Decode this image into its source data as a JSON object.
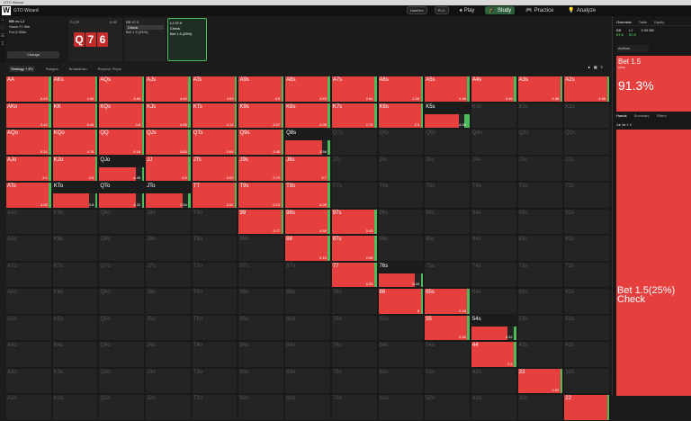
{
  "titlebar": "GTO Wizard",
  "app": {
    "name": "GTO Wizard",
    "mode": "Hold'em",
    "game": "PLO",
    "nav": [
      {
        "label": "Play"
      },
      {
        "label": "Study",
        "active": true
      },
      {
        "label": "Practice"
      },
      {
        "label": "Analyze"
      }
    ]
  },
  "spot": {
    "players": "BB vs LJ",
    "stack": "Stack 97.9bb",
    "pot": "Pot 5.95bb",
    "change_label": "Change",
    "flop_label": "FLOP",
    "flop_value": "5.95",
    "board": [
      "Q",
      "7",
      "6"
    ],
    "bb": {
      "label": "BB",
      "value": "97.9",
      "opt1": "Check",
      "opt2": "Bet 1.5",
      "opt2_pct": "(25%)"
    },
    "lj": {
      "label": "LJ",
      "value": "97.9",
      "opt1": "Check",
      "opt2": "Bet 1.5",
      "opt2_pct": "(25%)"
    }
  },
  "toolbar": {
    "strategy": "Strategy + EV",
    "ranges": "Ranges",
    "breakdown": "Breakdown",
    "reports": "Reports: Flops"
  },
  "right": {
    "tabs": [
      "Overview",
      "Table",
      "Equity"
    ],
    "bb_label": "BB",
    "bb_value": "97.9",
    "lj_label": "LJ",
    "lj_value": "97.9",
    "pot": "5.95 BB",
    "actions": "Actions",
    "action_title": "Bet 1.5",
    "action_pct": "(25%)",
    "action_freq": "91.3%",
    "hands_tabs": [
      "Hands",
      "Summary",
      "Filters"
    ],
    "filter": "A♠ 3♠  1  9",
    "big_label": "Bet 1.5(25%) Check"
  },
  "matrix": [
    [
      {
        "h": "AA",
        "ev": "6.23",
        "r": 0.95
      },
      {
        "h": "AKs",
        "ev": "4.49",
        "r": 0.96
      },
      {
        "h": "AQs",
        "ev": "3.84",
        "r": 0.96
      },
      {
        "h": "AJs",
        "ev": "4.49",
        "r": 0.96
      },
      {
        "h": "ATs",
        "ev": "4.53",
        "r": 0.96
      },
      {
        "h": "A9s",
        "ev": "4.5",
        "r": 0.96
      },
      {
        "h": "A8s",
        "ev": "4.53",
        "r": 0.96
      },
      {
        "h": "A7s",
        "ev": "2.81",
        "r": 0.96
      },
      {
        "h": "A6s",
        "ev": "2.28",
        "r": 0.96
      },
      {
        "h": "A5s",
        "ev": "4.49",
        "r": 0.96
      },
      {
        "h": "A4s",
        "ev": "4.46",
        "r": 0.96
      },
      {
        "h": "A3s",
        "ev": "4.38",
        "r": 0.96
      },
      {
        "h": "A2s",
        "ev": "4.38",
        "r": 0.96
      }
    ],
    [
      {
        "h": "AKo",
        "ev": "3.42",
        "r": 0.96
      },
      {
        "h": "KK",
        "ev": "5.44",
        "r": 0.96
      },
      {
        "h": "KQs",
        "ev": "3.8",
        "r": 0.96
      },
      {
        "h": "KJs",
        "ev": "4.05",
        "r": 0.96
      },
      {
        "h": "KTs",
        "ev": "4.12",
        "r": 0.96
      },
      {
        "h": "K9s",
        "ev": "4.07",
        "r": 0.96
      },
      {
        "h": "K8s",
        "ev": "4.05",
        "r": 0.96
      },
      {
        "h": "K7s",
        "ev": "2.75",
        "r": 0.96
      },
      {
        "h": "K6s",
        "ev": "2.5",
        "r": 0.96
      },
      {
        "h": "K5s",
        "ev": "4.05",
        "r": 0.9,
        "split": true
      },
      {
        "h": "K4s",
        "ev": "",
        "r": 0
      },
      {
        "h": "K3s",
        "ev": "",
        "r": 0
      },
      {
        "h": "K2s",
        "ev": "",
        "r": 0
      }
    ],
    [
      {
        "h": "AQo",
        "ev": "5.31",
        "r": 0.96
      },
      {
        "h": "KQo",
        "ev": "4.76",
        "r": 0.96
      },
      {
        "h": "QQ",
        "ev": "9.18",
        "r": 0.96
      },
      {
        "h": "QJs",
        "ev": "3.63",
        "r": 0.96
      },
      {
        "h": "QTs",
        "ev": "3.64",
        "r": 0.96
      },
      {
        "h": "Q9s",
        "ev": "3.45",
        "r": 0.96
      },
      {
        "h": "Q8s",
        "ev": "3.56",
        "r": 0.96,
        "split": true
      },
      {
        "h": "Q7s",
        "ev": "",
        "r": 0
      },
      {
        "h": "Q6s",
        "ev": "",
        "r": 0
      },
      {
        "h": "Q5s",
        "ev": "",
        "r": 0
      },
      {
        "h": "Q4s",
        "ev": "",
        "r": 0
      },
      {
        "h": "Q3s",
        "ev": "",
        "r": 0
      },
      {
        "h": "Q2s",
        "ev": "",
        "r": 0
      }
    ],
    [
      {
        "h": "AJo",
        "ev": "3.0",
        "r": 0.96
      },
      {
        "h": "KJo",
        "ev": "2.8",
        "r": 0.96
      },
      {
        "h": "QJo",
        "ev": "4.45",
        "r": 0.96,
        "split": true
      },
      {
        "h": "JJ",
        "ev": "4.5",
        "r": 0.96
      },
      {
        "h": "JTs",
        "ev": "3.62",
        "r": 0.96
      },
      {
        "h": "J9s",
        "ev": "3.73",
        "r": 0.96
      },
      {
        "h": "J8s",
        "ev": "3.7",
        "r": 0.96
      },
      {
        "h": "J7s",
        "ev": "",
        "r": 0
      },
      {
        "h": "J6s",
        "ev": "",
        "r": 0
      },
      {
        "h": "J5s",
        "ev": "",
        "r": 0
      },
      {
        "h": "J4s",
        "ev": "",
        "r": 0
      },
      {
        "h": "J3s",
        "ev": "",
        "r": 0
      },
      {
        "h": "J2s",
        "ev": "",
        "r": 0
      }
    ],
    [
      {
        "h": "ATo",
        "ev": "3.05",
        "r": 0.96
      },
      {
        "h": "KTo",
        "ev": "2.8",
        "r": 0.96,
        "split": true
      },
      {
        "h": "QTo",
        "ev": "4.32",
        "r": 0.96,
        "split": true
      },
      {
        "h": "JTo",
        "ev": "2.54",
        "r": 0.96,
        "split": true
      },
      {
        "h": "TT",
        "ev": "3.92",
        "r": 0.96
      },
      {
        "h": "T9s",
        "ev": "4.15",
        "r": 0.96
      },
      {
        "h": "T8s",
        "ev": "4.09",
        "r": 0.96
      },
      {
        "h": "T7s",
        "ev": "",
        "r": 0
      },
      {
        "h": "T6s",
        "ev": "",
        "r": 0
      },
      {
        "h": "T5s",
        "ev": "",
        "r": 0
      },
      {
        "h": "T4s",
        "ev": "",
        "r": 0
      },
      {
        "h": "T3s",
        "ev": "",
        "r": 0
      },
      {
        "h": "T2s",
        "ev": "",
        "r": 0
      }
    ],
    [
      {
        "h": "A9o",
        "ev": "",
        "r": 0
      },
      {
        "h": "K9o",
        "ev": "",
        "r": 0
      },
      {
        "h": "Q9o",
        "ev": "",
        "r": 0
      },
      {
        "h": "J9o",
        "ev": "",
        "r": 0
      },
      {
        "h": "T9o",
        "ev": "",
        "r": 0
      },
      {
        "h": "99",
        "ev": "3.77",
        "r": 0.96
      },
      {
        "h": "98s",
        "ev": "4.59",
        "r": 0.96
      },
      {
        "h": "97s",
        "ev": "2.43",
        "r": 0.96
      },
      {
        "h": "96s",
        "ev": "",
        "r": 0
      },
      {
        "h": "95s",
        "ev": "",
        "r": 0
      },
      {
        "h": "94s",
        "ev": "",
        "r": 0
      },
      {
        "h": "93s",
        "ev": "",
        "r": 0
      },
      {
        "h": "92s",
        "ev": "",
        "r": 0
      }
    ],
    [
      {
        "h": "A8o",
        "ev": "",
        "r": 0
      },
      {
        "h": "K8o",
        "ev": "",
        "r": 0
      },
      {
        "h": "Q8o",
        "ev": "",
        "r": 0
      },
      {
        "h": "J8o",
        "ev": "",
        "r": 0
      },
      {
        "h": "T8o",
        "ev": "",
        "r": 0
      },
      {
        "h": "98o",
        "ev": "",
        "r": 0
      },
      {
        "h": "88",
        "ev": "3.19",
        "r": 0.96
      },
      {
        "h": "87s",
        "ev": "2.65",
        "r": 0.96
      },
      {
        "h": "86s",
        "ev": "",
        "r": 0
      },
      {
        "h": "85s",
        "ev": "",
        "r": 0
      },
      {
        "h": "84s",
        "ev": "",
        "r": 0
      },
      {
        "h": "83s",
        "ev": "",
        "r": 0
      },
      {
        "h": "82s",
        "ev": "",
        "r": 0
      }
    ],
    [
      {
        "h": "A7o",
        "ev": "",
        "r": 0
      },
      {
        "h": "K7o",
        "ev": "",
        "r": 0
      },
      {
        "h": "Q7o",
        "ev": "",
        "r": 0
      },
      {
        "h": "J7o",
        "ev": "",
        "r": 0
      },
      {
        "h": "T7o",
        "ev": "",
        "r": 0
      },
      {
        "h": "97o",
        "ev": "",
        "r": 0
      },
      {
        "h": "87o",
        "ev": "",
        "r": 0
      },
      {
        "h": "77",
        "ev": "6.55",
        "r": 0.96
      },
      {
        "h": "76s",
        "ev": "5.43",
        "r": 0.96,
        "split": true
      },
      {
        "h": "75s",
        "ev": "",
        "r": 0
      },
      {
        "h": "74s",
        "ev": "",
        "r": 0
      },
      {
        "h": "73s",
        "ev": "",
        "r": 0
      },
      {
        "h": "72s",
        "ev": "",
        "r": 0
      }
    ],
    [
      {
        "h": "A6o",
        "ev": "",
        "r": 0
      },
      {
        "h": "K6o",
        "ev": "",
        "r": 0
      },
      {
        "h": "Q6o",
        "ev": "",
        "r": 0
      },
      {
        "h": "J6o",
        "ev": "",
        "r": 0
      },
      {
        "h": "T6o",
        "ev": "",
        "r": 0
      },
      {
        "h": "96o",
        "ev": "",
        "r": 0
      },
      {
        "h": "86o",
        "ev": "",
        "r": 0
      },
      {
        "h": "76o",
        "ev": "",
        "r": 0
      },
      {
        "h": "66",
        "ev": "8",
        "r": 0.96
      },
      {
        "h": "65s",
        "ev": "2.16",
        "r": 0.96
      },
      {
        "h": "64s",
        "ev": "",
        "r": 0
      },
      {
        "h": "63s",
        "ev": "",
        "r": 0
      },
      {
        "h": "62s",
        "ev": "",
        "r": 0
      }
    ],
    [
      {
        "h": "A5o",
        "ev": "",
        "r": 0
      },
      {
        "h": "K5o",
        "ev": "",
        "r": 0
      },
      {
        "h": "Q5o",
        "ev": "",
        "r": 0
      },
      {
        "h": "J5o",
        "ev": "",
        "r": 0
      },
      {
        "h": "T5o",
        "ev": "",
        "r": 0
      },
      {
        "h": "95o",
        "ev": "",
        "r": 0
      },
      {
        "h": "85o",
        "ev": "",
        "r": 0
      },
      {
        "h": "75o",
        "ev": "",
        "r": 0
      },
      {
        "h": "65o",
        "ev": "",
        "r": 0
      },
      {
        "h": "55",
        "ev": "3.34",
        "r": 0.96
      },
      {
        "h": "54s",
        "ev": "4.32",
        "r": 0.96,
        "split": true
      },
      {
        "h": "53s",
        "ev": "",
        "r": 0
      },
      {
        "h": "52s",
        "ev": "",
        "r": 0
      }
    ],
    [
      {
        "h": "A4o",
        "ev": "",
        "r": 0
      },
      {
        "h": "K4o",
        "ev": "",
        "r": 0
      },
      {
        "h": "Q4o",
        "ev": "",
        "r": 0
      },
      {
        "h": "J4o",
        "ev": "",
        "r": 0
      },
      {
        "h": "T4o",
        "ev": "",
        "r": 0
      },
      {
        "h": "94o",
        "ev": "",
        "r": 0
      },
      {
        "h": "84o",
        "ev": "",
        "r": 0
      },
      {
        "h": "74o",
        "ev": "",
        "r": 0
      },
      {
        "h": "64o",
        "ev": "",
        "r": 0
      },
      {
        "h": "54o",
        "ev": "",
        "r": 0
      },
      {
        "h": "44",
        "ev": "2.9",
        "r": 0.96
      },
      {
        "h": "43s",
        "ev": "",
        "r": 0
      },
      {
        "h": "42s",
        "ev": "",
        "r": 0
      }
    ],
    [
      {
        "h": "A3o",
        "ev": "",
        "r": 0
      },
      {
        "h": "K3o",
        "ev": "",
        "r": 0
      },
      {
        "h": "Q3o",
        "ev": "",
        "r": 0
      },
      {
        "h": "J3o",
        "ev": "",
        "r": 0
      },
      {
        "h": "T3o",
        "ev": "",
        "r": 0
      },
      {
        "h": "93o",
        "ev": "",
        "r": 0
      },
      {
        "h": "83o",
        "ev": "",
        "r": 0
      },
      {
        "h": "73o",
        "ev": "",
        "r": 0
      },
      {
        "h": "63o",
        "ev": "",
        "r": 0
      },
      {
        "h": "53o",
        "ev": "",
        "r": 0
      },
      {
        "h": "43o",
        "ev": "",
        "r": 0
      },
      {
        "h": "33",
        "ev": "2.02",
        "r": 0.96
      },
      {
        "h": "32s",
        "ev": "",
        "r": 0
      }
    ],
    [
      {
        "h": "A2o",
        "ev": "",
        "r": 0
      },
      {
        "h": "K2o",
        "ev": "",
        "r": 0
      },
      {
        "h": "Q2o",
        "ev": "",
        "r": 0
      },
      {
        "h": "J2o",
        "ev": "",
        "r": 0
      },
      {
        "h": "T2o",
        "ev": "",
        "r": 0
      },
      {
        "h": "92o",
        "ev": "",
        "r": 0
      },
      {
        "h": "82o",
        "ev": "",
        "r": 0
      },
      {
        "h": "72o",
        "ev": "",
        "r": 0
      },
      {
        "h": "62o",
        "ev": "",
        "r": 0
      },
      {
        "h": "52o",
        "ev": "",
        "r": 0
      },
      {
        "h": "42o",
        "ev": "",
        "r": 0
      },
      {
        "h": "32o",
        "ev": "",
        "r": 0
      },
      {
        "h": "22",
        "ev": "",
        "r": 0.96
      }
    ]
  ],
  "colors": {
    "bet": "#e5403e",
    "check": "#4dbb5a",
    "empty": "#242424"
  }
}
